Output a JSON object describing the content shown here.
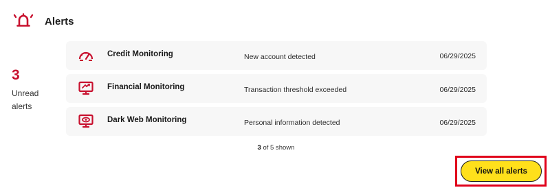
{
  "header": {
    "title": "Alerts",
    "icon": "bell-alert-icon"
  },
  "summary": {
    "count": "3",
    "label": "Unread alerts"
  },
  "alerts": [
    {
      "name": "Credit Monitoring",
      "description": "New account detected",
      "date": "06/29/2025",
      "icon": "speedometer-icon"
    },
    {
      "name": "Financial Monitoring",
      "description": "Transaction threshold exceeded",
      "date": "06/29/2025",
      "icon": "monitor-exchange-icon"
    },
    {
      "name": "Dark Web Monitoring",
      "description": "Personal information detected",
      "date": "06/29/2025",
      "icon": "monitor-eye-icon"
    }
  ],
  "pagination": {
    "shown": "3",
    "rest": " of 5 shown"
  },
  "actions": {
    "view_all_label": "View all alerts"
  },
  "colors": {
    "accent_red": "#c8102e",
    "button_yellow": "#ffe01b",
    "row_bg": "#f7f7f7",
    "highlight_border": "#e0001a"
  }
}
